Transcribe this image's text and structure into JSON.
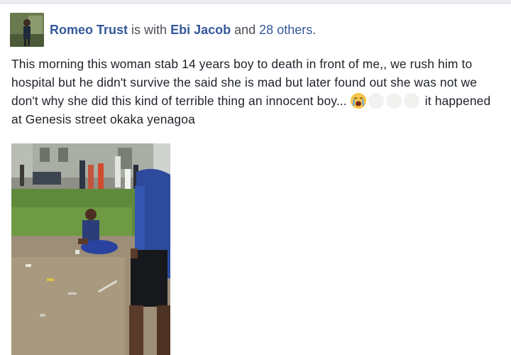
{
  "post": {
    "author": "Romeo Trust",
    "with_word": "is with",
    "tagged": "Ebi Jacob",
    "and_word": "and",
    "others": "28 others",
    "period": ".",
    "text": "This morning this woman stab 14 years boy to death in front of me,, we rush him to hospital but he didn't survive the said she is mad but later found out she was not we don't why she did this kind of terrible thing an innocent boy...",
    "text_after_emoji": "it happened at Genesis street okaka yenagoa",
    "emojis": [
      "crying-face-icon",
      "faded-emoji-icon",
      "faded-emoji-icon",
      "faded-emoji-icon"
    ]
  },
  "colors": {
    "link": "#365899",
    "text": "#1d2129",
    "background": "#e9ebee"
  }
}
